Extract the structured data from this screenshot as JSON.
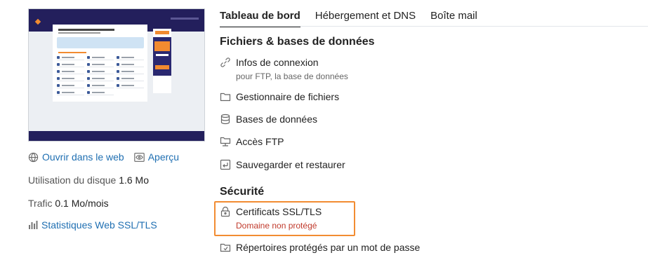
{
  "links": {
    "open_web": "Ouvrir dans le web",
    "preview": "Aperçu"
  },
  "disk": {
    "label": "Utilisation du disque",
    "value": "1.6 Mo"
  },
  "traffic": {
    "label": "Trafic",
    "value": "0.1 Mo/mois"
  },
  "stats_link": "Statistiques Web SSL/TLS",
  "tabs": [
    {
      "label": "Tableau de bord",
      "active": true
    },
    {
      "label": "Hébergement et DNS",
      "active": false
    },
    {
      "label": "Boîte mail",
      "active": false
    }
  ],
  "sections": {
    "files": {
      "title": "Fichiers & bases de données",
      "items": [
        {
          "label": "Infos de connexion",
          "sub": "pour FTP, la base de données",
          "icon": "connection-icon"
        },
        {
          "label": "Gestionnaire de fichiers",
          "icon": "folder-icon"
        },
        {
          "label": "Bases de données",
          "icon": "database-icon"
        },
        {
          "label": "Accès FTP",
          "icon": "ftp-icon"
        },
        {
          "label": "Sauvegarder et restaurer",
          "icon": "backup-icon"
        }
      ]
    },
    "security": {
      "title": "Sécurité",
      "items": [
        {
          "label": "Certificats SSL/TLS",
          "sub": "Domaine non protégé",
          "icon": "ssl-lock-icon",
          "highlighted": true
        },
        {
          "label": "Répertoires protégés par un mot de passe",
          "icon": "protected-folder-icon"
        }
      ]
    }
  },
  "colors": {
    "link": "#1f6fb2",
    "error": "#c0392b",
    "highlight": "#f28c32"
  }
}
